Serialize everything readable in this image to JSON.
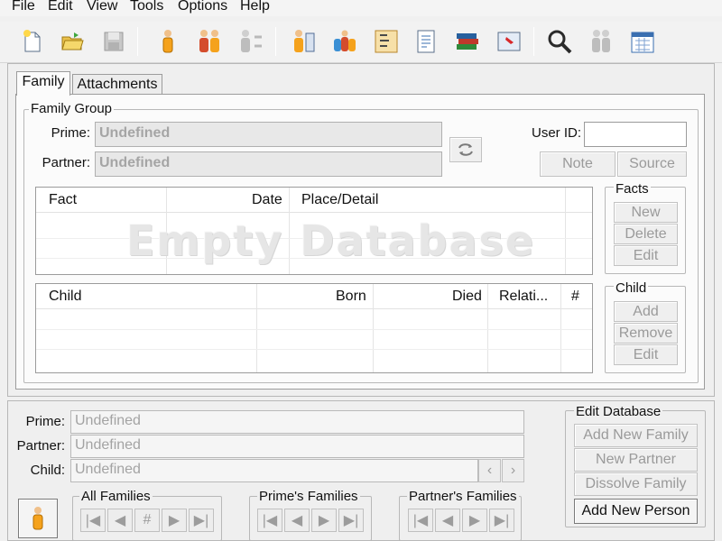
{
  "menu": [
    "File",
    "Edit",
    "View",
    "Tools",
    "Options",
    "Help"
  ],
  "toolbar_icons": [
    "new-file-icon",
    "open-folder-icon",
    "save-disk-icon",
    "person-icon",
    "family-icon",
    "swap-persons-icon",
    "list-people-icon",
    "group-icon",
    "pedigree-chart-icon",
    "report-icon",
    "books-icon",
    "pin-note-icon",
    "search-icon",
    "people-grey-icon",
    "calendar-icon"
  ],
  "tabs": [
    "Family",
    "Attachments"
  ],
  "family_group": {
    "title": "Family Group",
    "prime_label": "Prime:",
    "prime_value": "Undefined",
    "partner_label": "Partner:",
    "partner_value": "Undefined",
    "user_id_label": "User ID:",
    "user_id_value": "",
    "note_button": "Note",
    "source_button": "Source"
  },
  "facts_table": {
    "columns": [
      "Fact",
      "Date",
      "Place/Detail"
    ],
    "watermark": "Empty Database"
  },
  "facts_group": {
    "title": "Facts",
    "buttons": [
      "New",
      "Delete",
      "Edit"
    ]
  },
  "child_table": {
    "columns": [
      "Child",
      "Born",
      "Died",
      "Relati...",
      "#"
    ]
  },
  "child_group": {
    "title": "Child",
    "buttons": [
      "Add",
      "Remove",
      "Edit"
    ]
  },
  "bottom": {
    "prime_label": "Prime:",
    "prime_value": "Undefined",
    "partner_label": "Partner:",
    "partner_value": "Undefined",
    "child_label": "Child:",
    "child_value": "Undefined",
    "all_families": "All Families",
    "primes_families": "Prime's Families",
    "partners_families": "Partner's Families",
    "hash_symbol": "#"
  },
  "edit_database": {
    "title": "Edit Database",
    "add_new_family": "Add New Family",
    "new_partner": "New Partner",
    "dissolve_family": "Dissolve Family",
    "add_new_person": "Add New Person"
  }
}
